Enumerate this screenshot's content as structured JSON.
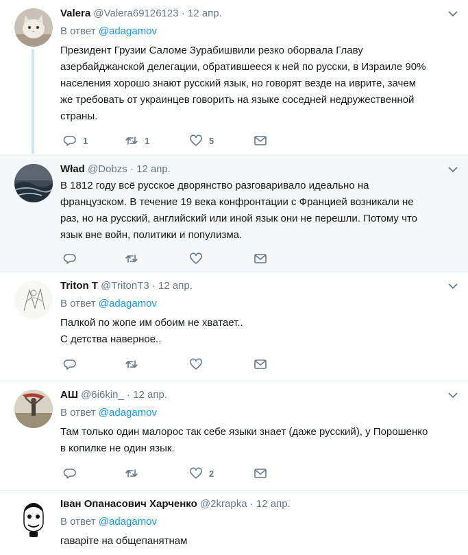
{
  "reply_prefix": "В ответ",
  "tweets": [
    {
      "name": "Valera",
      "handle": "@Valera69126123",
      "time": "12 апр.",
      "reply_to": "@adagamov",
      "lines": [
        "Президент Грузии Саломе Зурабишвили резко оборвала Главу",
        "азербайджанской делегации, обратившееся к ней по русски, в Израиле 90%",
        "населения хорошо знают русский язык, но говорят везде на иврите, зачем",
        "же требовать от украинцев говорить на языке соседней недружественной",
        "страны."
      ],
      "replies": "1",
      "retweets": "1",
      "likes": "5"
    },
    {
      "name": "Wład",
      "handle": "@Dobzs",
      "time": "12 апр.",
      "lines": [
        "В 1812 году всё русское дворянство разговаривало идеально на",
        "французском. В течение 19 века конфронтации с Францией возникали не",
        "раз, но на русский, английский или иной язык они не перешли. Потому что",
        "язык вне войн, политики и популизма."
      ],
      "replies": "",
      "retweets": "",
      "likes": ""
    },
    {
      "name": "Triton T",
      "handle": "@TritonT3",
      "time": "12 апр.",
      "reply_to": "@adagamov",
      "lines": [
        "Палкой по жопе им обоим не хватает..",
        "С детства наверное.."
      ],
      "replies": "",
      "retweets": "",
      "likes": ""
    },
    {
      "name": "АШ",
      "handle": "@6i6kin_",
      "time": "12 апр.",
      "reply_to": "@adagamov",
      "lines": [
        "Там только один малорос так себе языки знает (даже русский), у Порошенко",
        "в копилке не один язык."
      ],
      "replies": "",
      "retweets": "",
      "likes": "2"
    },
    {
      "name": "Іван Опанасович Харченко",
      "handle": "@2krapka",
      "time": "12 апр.",
      "reply_to": "@adagamov",
      "lines": [
        "гаваріте на общепанятнам"
      ]
    }
  ],
  "separator": "·",
  "icons": {
    "reply": "reply-icon",
    "retweet": "retweet-icon",
    "like": "heart-icon",
    "dm": "envelope-icon",
    "more": "chevron-down-icon"
  },
  "colors": {
    "link": "#1b95e0",
    "muted": "#657786",
    "text": "#14171a",
    "highlight_bg": "#f5f8fa",
    "thread_line": "#cfe4f6"
  }
}
